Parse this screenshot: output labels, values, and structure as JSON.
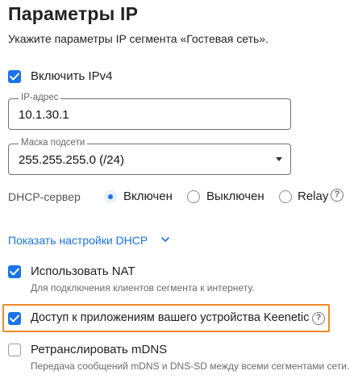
{
  "page": {
    "title": "Параметры IP",
    "subtitle": "Укажите параметры IP сегмента «Гостевая сеть»."
  },
  "ipv4": {
    "label": "Включить IPv4",
    "checked": true
  },
  "ip_field": {
    "label": "IP-адрес",
    "value": "10.1.30.1"
  },
  "mask_field": {
    "label": "Маска подсети",
    "value": "255.255.255.0 (/24)"
  },
  "dhcp": {
    "label": "DHCP-сервер",
    "options": [
      {
        "label": "Включен",
        "selected": true
      },
      {
        "label": "Выключен",
        "selected": false
      },
      {
        "label": "Relay",
        "selected": false
      }
    ],
    "help_icon": "question-circle-icon"
  },
  "dhcp_link": {
    "label": "Показать настройки DHCP",
    "icon": "chevron-down-icon"
  },
  "nat": {
    "label": "Использовать NAT",
    "checked": true,
    "hint": "Для подключения клиентов сегмента к интернету."
  },
  "keenetic_access": {
    "label": "Доступ к приложениям вашего устройства Keenetic",
    "checked": true,
    "help_icon": "question-circle-icon"
  },
  "mdns": {
    "label": "Ретранслировать mDNS",
    "checked": false,
    "hint": "Передача сообщений mDNS и DNS-SD между всеми сегментами сети."
  },
  "colors": {
    "accent": "#1a73e8",
    "highlight": "#f08a24"
  }
}
